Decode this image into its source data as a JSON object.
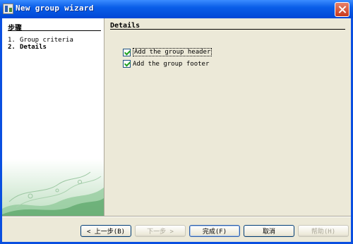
{
  "window": {
    "title": "New group wizard"
  },
  "steps": {
    "heading": "步骤",
    "items": [
      {
        "num": "1.",
        "label": "Group criteria"
      },
      {
        "num": "2.",
        "label": "Details"
      }
    ]
  },
  "details": {
    "heading": "Details",
    "options": [
      {
        "label": "Add the group header",
        "checked": true
      },
      {
        "label": "Add the group footer",
        "checked": true
      }
    ]
  },
  "buttons": {
    "back": "< 上一步(B)",
    "next": "下一步 >",
    "finish": "完成(F)",
    "cancel": "取消",
    "help": "帮助(H)"
  }
}
